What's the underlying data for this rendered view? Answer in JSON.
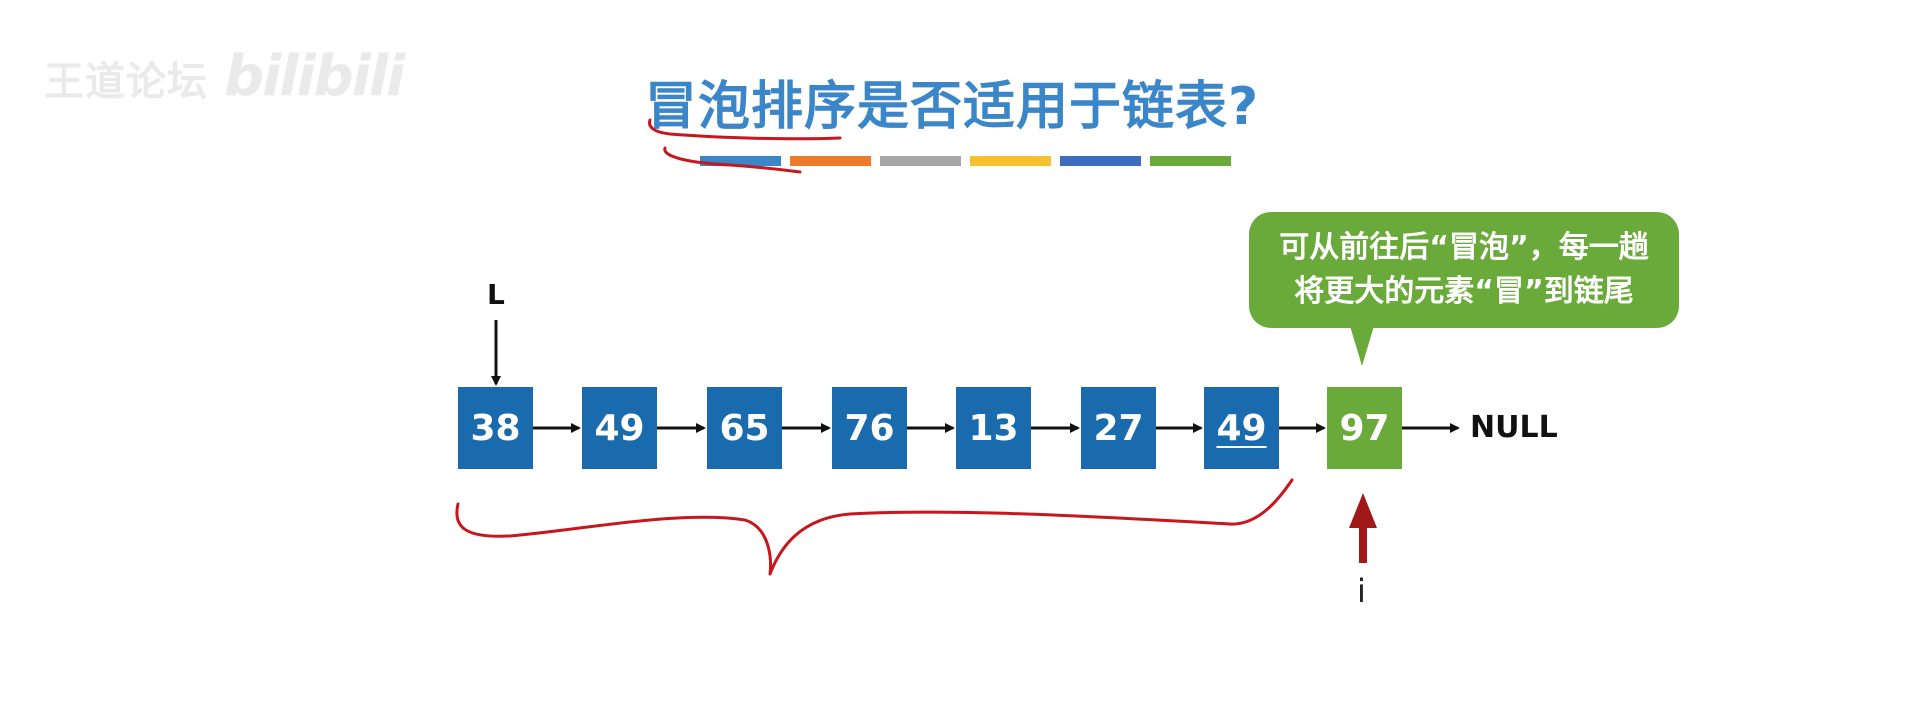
{
  "watermark": {
    "text_cn": "王道论坛",
    "logo": "bilibili"
  },
  "title": "冒泡排序是否适用于链表?",
  "color_bars": [
    "#3a86c8",
    "#ee7a2c",
    "#a6a6a6",
    "#f6c02e",
    "#3e6dc0",
    "#6aaa3a"
  ],
  "callout": {
    "line1": "可从前往后“冒泡”，每一趟",
    "line2": "将更大的元素“冒”到链尾"
  },
  "head_label": "L",
  "nodes": [
    {
      "value": "38",
      "color": "blue"
    },
    {
      "value": "49",
      "color": "blue"
    },
    {
      "value": "65",
      "color": "blue"
    },
    {
      "value": "76",
      "color": "blue"
    },
    {
      "value": "13",
      "color": "blue"
    },
    {
      "value": "27",
      "color": "blue"
    },
    {
      "value": "49",
      "color": "blue",
      "underlined": true
    },
    {
      "value": "97",
      "color": "green"
    }
  ],
  "null_label": "NULL",
  "pointer_label": "i",
  "colors": {
    "title": "#3a86c8",
    "node_blue": "#1a6aae",
    "node_green": "#6aaa3a",
    "annotation_red": "#c8161e",
    "pointer_arrow": "#a01818"
  }
}
